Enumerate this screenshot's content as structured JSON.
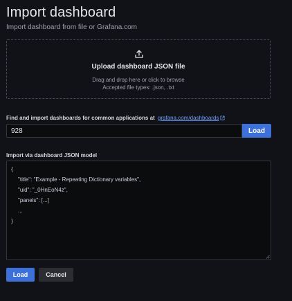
{
  "header": {
    "title": "Import dashboard",
    "subtitle": "Import dashboard from file or Grafana.com"
  },
  "upload": {
    "icon": "upload-icon",
    "title": "Upload dashboard JSON file",
    "hint": "Drag and drop here or click to browse",
    "accepted_types": "Accepted file types: .json, .txt"
  },
  "grafana_import": {
    "label": "Find and import dashboards for common applications at",
    "link_text": "grafana.com/dashboards",
    "link_icon": "external-link-icon",
    "input_value": "928",
    "button_label": "Load"
  },
  "json_model": {
    "label": "Import via dashboard JSON model",
    "lines": [
      "{",
      "\"title\": \"Example - Repeating Dictionary variables\",",
      "\"uid\": \"_0HnEoN4z\",",
      "\"panels\": [...]",
      "...",
      "}"
    ]
  },
  "actions": {
    "load_label": "Load",
    "cancel_label": "Cancel"
  },
  "colors": {
    "background": "#111217",
    "primary_button": "#3d71d9",
    "secondary_button": "#2c2d33",
    "link": "#6e9fff",
    "input_background": "#0b0c0e",
    "border": "#34363d"
  }
}
